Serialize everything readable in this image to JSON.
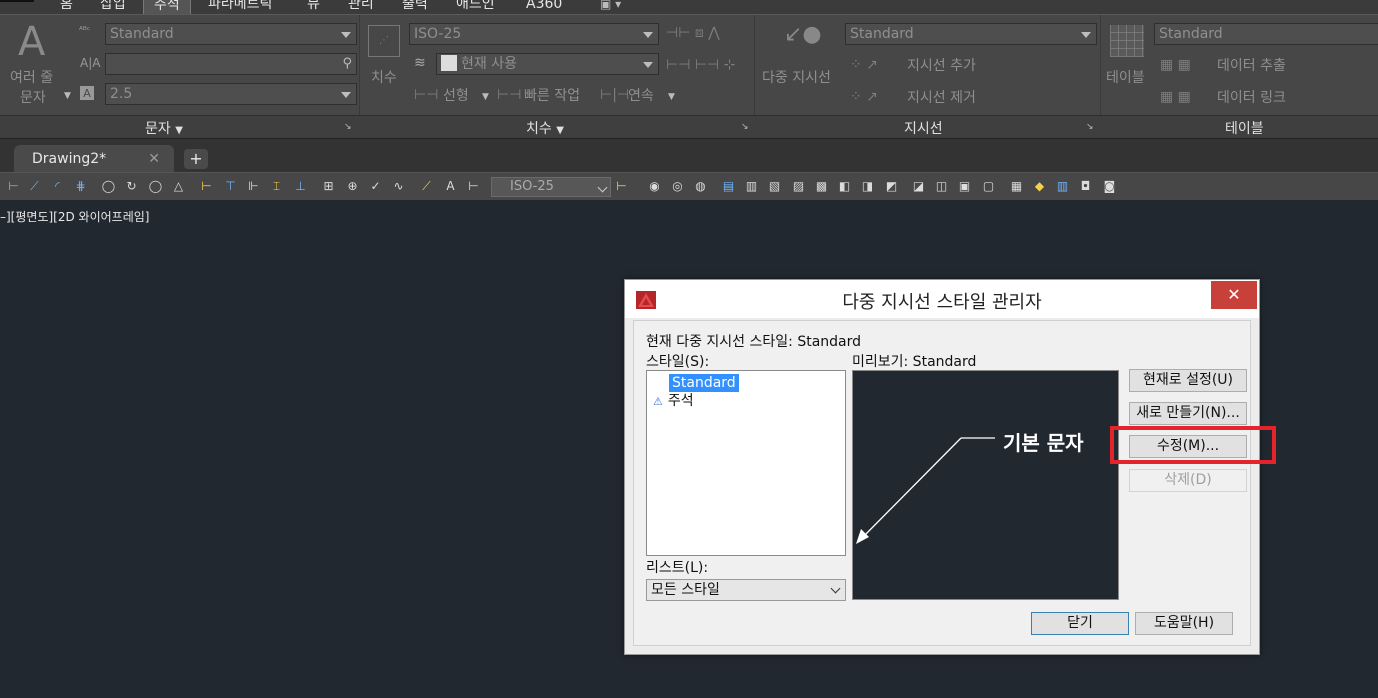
{
  "ribbon_tabs": [
    "홈",
    "삽입",
    "주석",
    "파라메트릭",
    "뷰",
    "관리",
    "출력",
    "애드인",
    "A360"
  ],
  "ribbon_active_tab": "주석",
  "text_panel": {
    "big_button_top": "여러 줄",
    "big_button_bottom": "문자",
    "style_combo": "Standard",
    "search_placeholder": "",
    "height_combo": "2.5",
    "title": "문자"
  },
  "dim_panel": {
    "big_button": "치수",
    "style_combo": "ISO-25",
    "layer_combo": "현재 사용",
    "linear": "선형",
    "quick": "빠른 작업",
    "continue": "연속",
    "title": "치수"
  },
  "leader_panel": {
    "big_button": "다중 지시선",
    "style_combo": "Standard",
    "add": "지시선 추가",
    "remove": "지시선 제거",
    "title": "지시선"
  },
  "table_panel": {
    "big_button": "테이블",
    "style_combo": "Standard",
    "extract": "데이터 추출",
    "link": "데이터 링크",
    "title": "테이블"
  },
  "doc_tab": {
    "name": "Drawing2*",
    "close": "✕",
    "new": "+"
  },
  "toolbar": {
    "dim_style": "ISO-25"
  },
  "viewport_label": "–][평면도][2D 와이어프레임]",
  "dialog": {
    "title": "다중 지시선 스타일 관리자",
    "close": "✕",
    "current_style": "현재 다중 지시선 스타일: Standard",
    "styles_label": "스타일(S):",
    "styles": [
      "Standard",
      "주석"
    ],
    "selected_style": "Standard",
    "preview_label": "미리보기: Standard",
    "preview_text": "기본 문자",
    "list_label": "리스트(L):",
    "list_value": "모든 스타일",
    "buttons": {
      "set_current": "현재로 설정(U)",
      "new": "새로 만들기(N)...",
      "modify": "수정(M)...",
      "delete": "삭제(D)",
      "close": "닫기",
      "help": "도움말(H)"
    }
  },
  "colors": {
    "highlight": "#e3242b",
    "canvas": "#212830",
    "selection": "#3390ff",
    "close": "#c8403a"
  }
}
